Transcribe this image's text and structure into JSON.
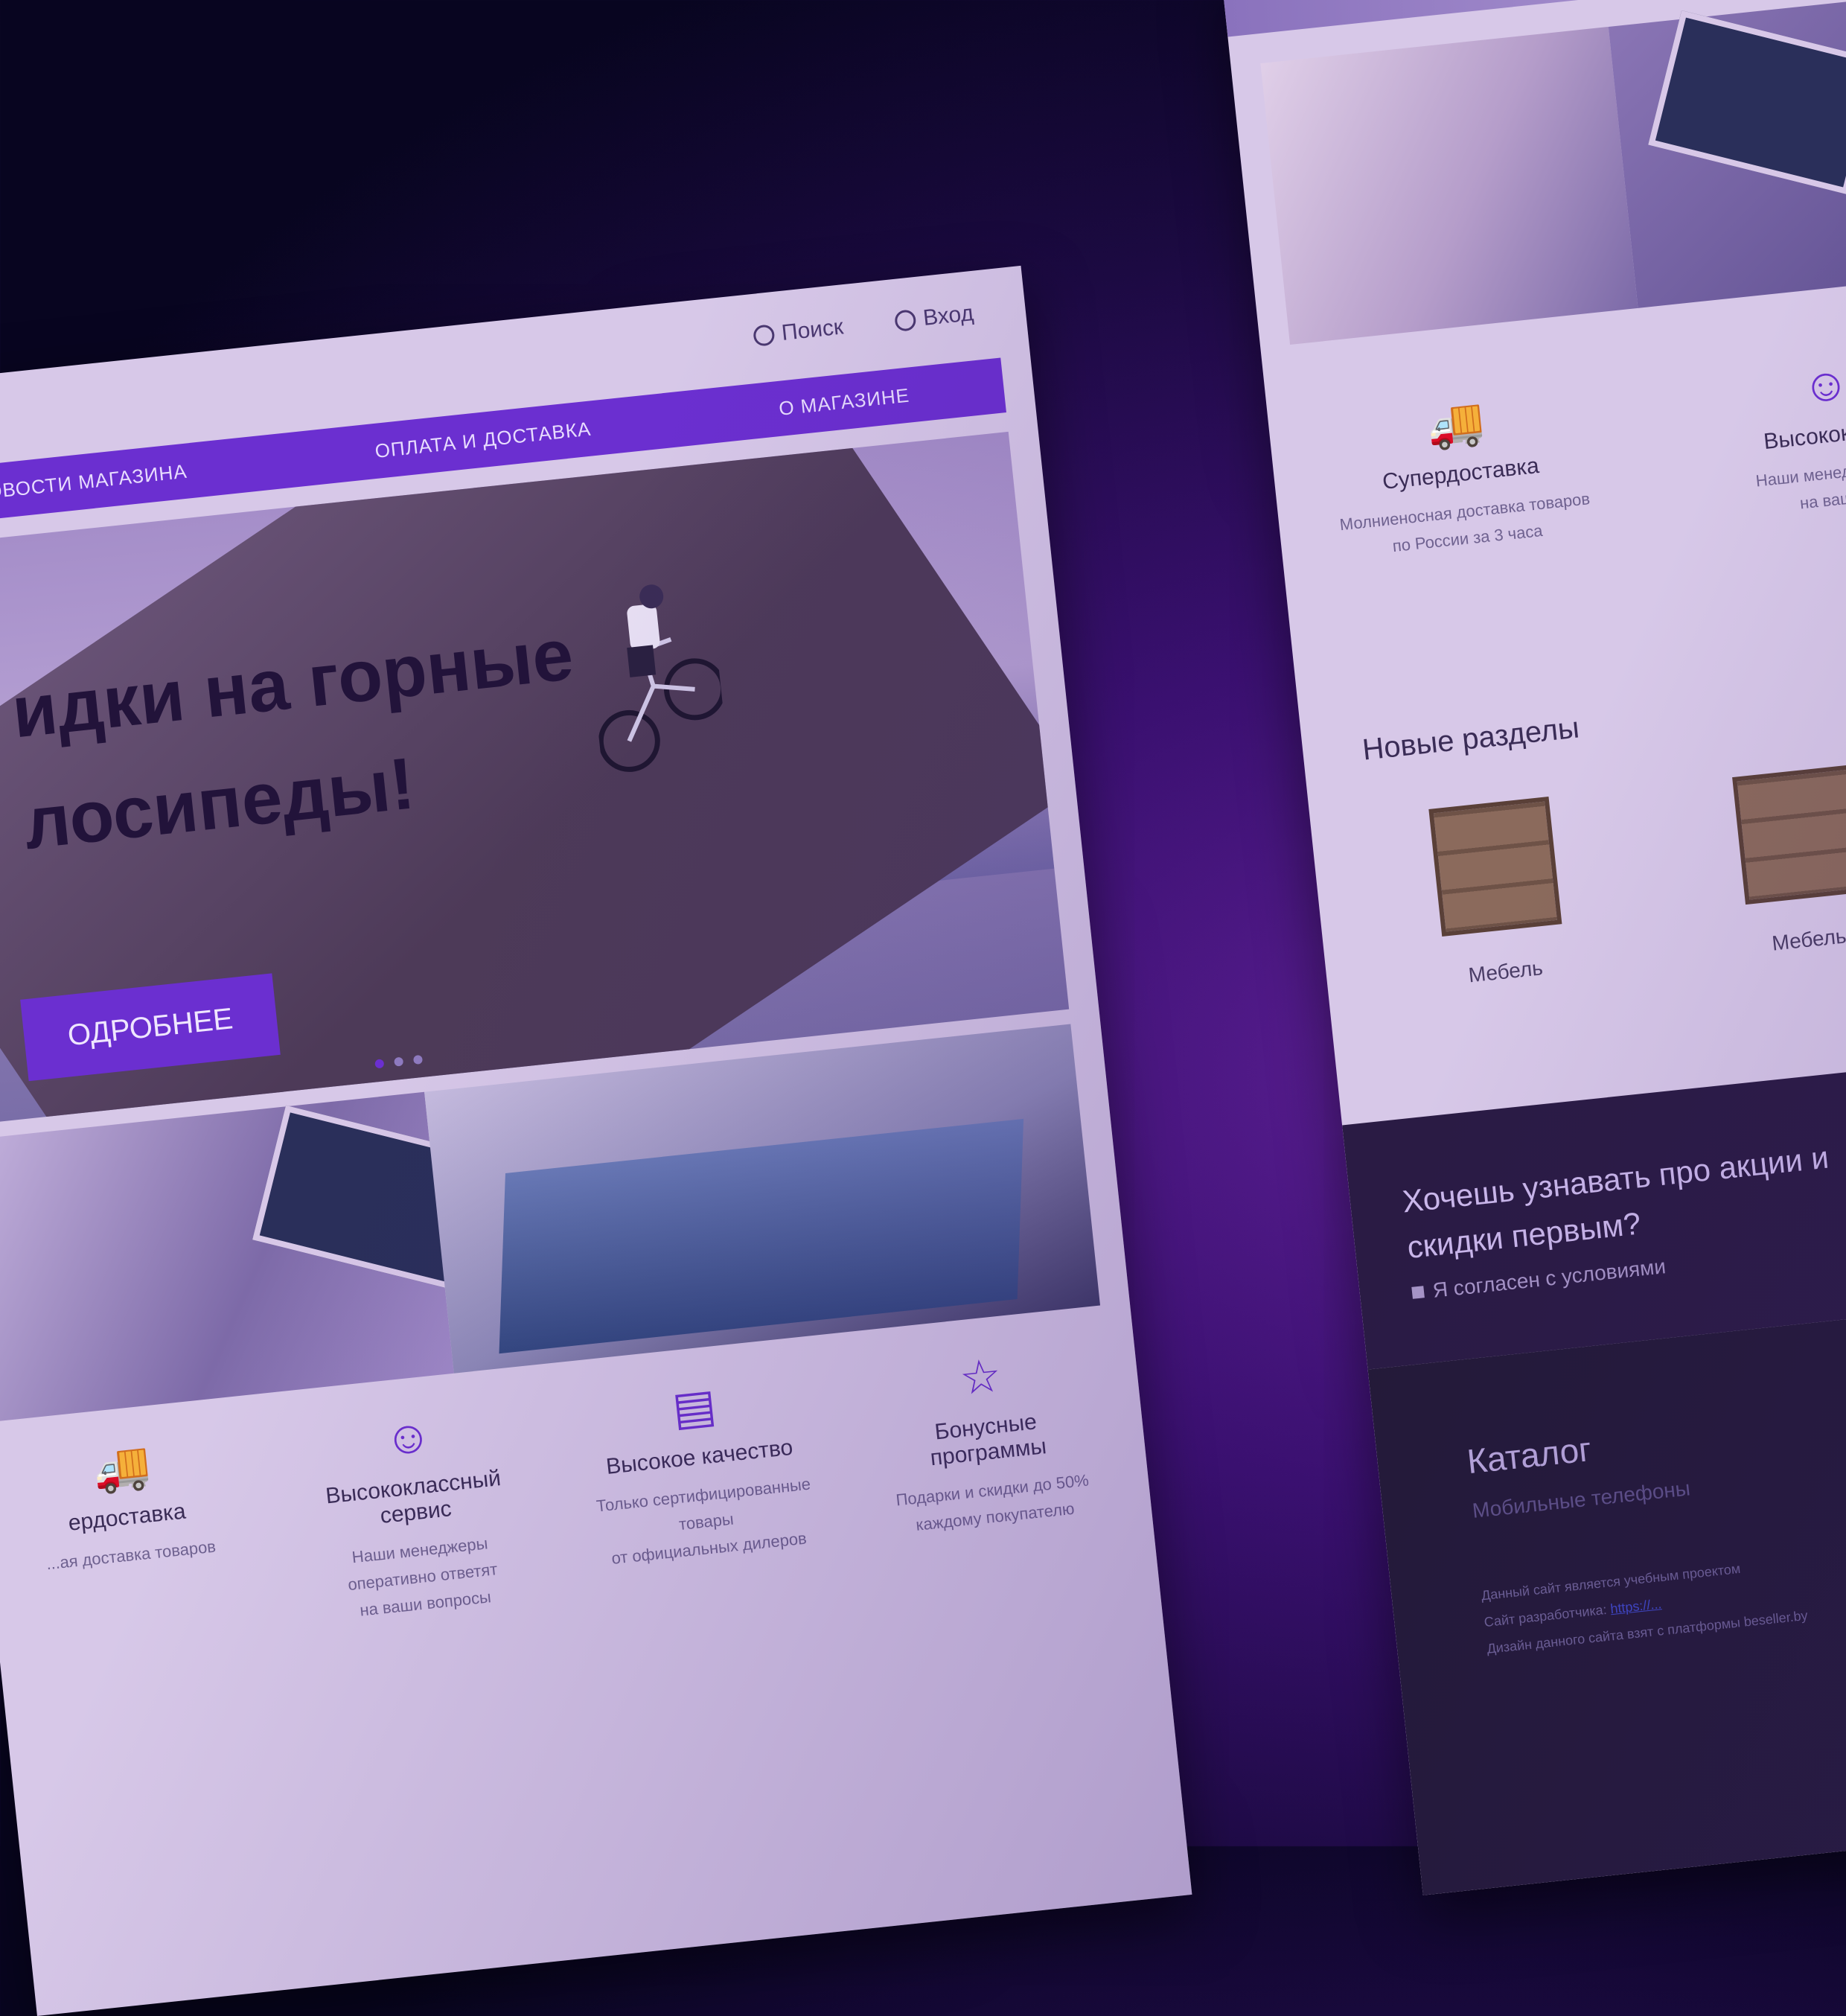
{
  "page1": {
    "header": {
      "search_label": "Поиск",
      "login_label": "Вход"
    },
    "nav": [
      {
        "label": "НОВОСТИ МАГАЗИНА"
      },
      {
        "label": "ОПЛАТА И ДОСТАВКА"
      },
      {
        "label": "О МАГАЗИНЕ"
      }
    ],
    "hero": {
      "title_line1": "идки на горные",
      "title_line2": "лосипеды!",
      "button_label": "ОДРОБНЕЕ",
      "slide_count": 3,
      "active_slide": 1
    },
    "features": [
      {
        "icon": "truck-icon",
        "title": "ердоставка",
        "desc_line1": "...ая доставка товаров",
        "desc_line2": ""
      },
      {
        "icon": "smile-icon",
        "title": "Высококлассный сервис",
        "desc_line1": "Наши менеджеры оперативно ответят",
        "desc_line2": "на ваши вопросы"
      },
      {
        "icon": "document-icon",
        "title": "Высокое качество",
        "desc_line1": "Только сертифицированные товары",
        "desc_line2": "от официальных дилеров"
      },
      {
        "icon": "star-icon",
        "title": "Бонусные программы",
        "desc_line1": "Подарки и скидки до 50%",
        "desc_line2": "каждому покупателю"
      }
    ]
  },
  "page2": {
    "features": [
      {
        "icon": "truck-icon",
        "title": "Супердоставка",
        "desc_line1": "Молниеносная доставка товаров",
        "desc_line2": "по России за 3 часа"
      },
      {
        "icon": "smile-icon",
        "title": "Высококласс",
        "desc_line1": "Наши менеджеры оп",
        "desc_line2": "на ваши в"
      }
    ],
    "section_title": "Новые разделы",
    "categories": [
      {
        "name": "Мебель",
        "icon": "shelf-icon"
      },
      {
        "name": "Мебель",
        "icon": "shelf-icon"
      }
    ],
    "subscribe": {
      "question_line1": "Хочешь узнавать про акции и",
      "question_line2": "скидки первым?",
      "agree_label": "Я согласен с условиями"
    },
    "footer": {
      "catalog_title": "Каталог",
      "catalog_link": "Мобильные телефоны",
      "note1": "Данный сайт является учебным проектом",
      "note2_prefix": "Сайт разработчика:",
      "note2_link": "https://...",
      "note3": "Дизайн данного сайта взят с платформы beseller.by"
    }
  },
  "colors": {
    "accent": "#6b2fd0",
    "background_dark": "#1c0a42",
    "footer_bg": "#231a38"
  }
}
